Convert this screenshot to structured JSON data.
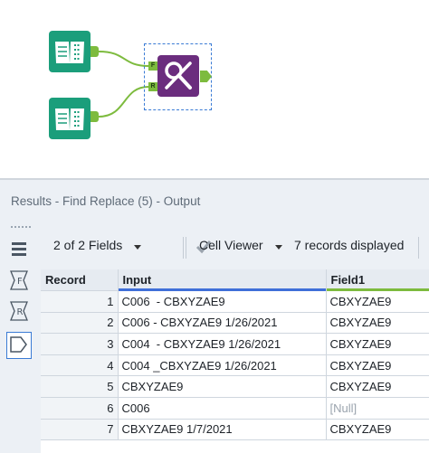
{
  "canvas": {
    "input1_anchor_label": "F",
    "input2_anchor_label": "R"
  },
  "results": {
    "title": "Results - Find Replace (5) - Output",
    "toolbar": {
      "fields_selector": "2 of 2 Fields",
      "viewer_selector": "Cell Viewer",
      "records_displayed": "7 records displayed"
    },
    "columns": [
      "Record",
      "Input",
      "Field1"
    ],
    "column_colors": {
      "input": "#3f6fd8",
      "field1": "#7dbb3e"
    },
    "rows": [
      {
        "record": "1",
        "input": "C006  - CBXYZAE9",
        "field1": "CBXYZAE9"
      },
      {
        "record": "2",
        "input": "C006 - CBXYZAE9 1/26/2021",
        "field1": "CBXYZAE9"
      },
      {
        "record": "3",
        "input": "C004  - CBXYZAE9 1/26/2021",
        "field1": "CBXYZAE9"
      },
      {
        "record": "4",
        "input": "C004 _CBXYZAE9 1/26/2021",
        "field1": "CBXYZAE9"
      },
      {
        "record": "5",
        "input": "CBXYZAE9",
        "field1": "CBXYZAE9"
      },
      {
        "record": "6",
        "input": "C006",
        "field1": "[Null]"
      },
      {
        "record": "7",
        "input": "CBXYZAE9 1/7/2021",
        "field1": "CBXYZAE9"
      }
    ]
  },
  "icons": {
    "input_tool": "book-icon",
    "find_replace_tool": "find-replace-icon",
    "check": "check-icon",
    "rail": [
      "list-icon",
      "field-f-icon",
      "field-r-icon",
      "output-tag-icon"
    ]
  }
}
